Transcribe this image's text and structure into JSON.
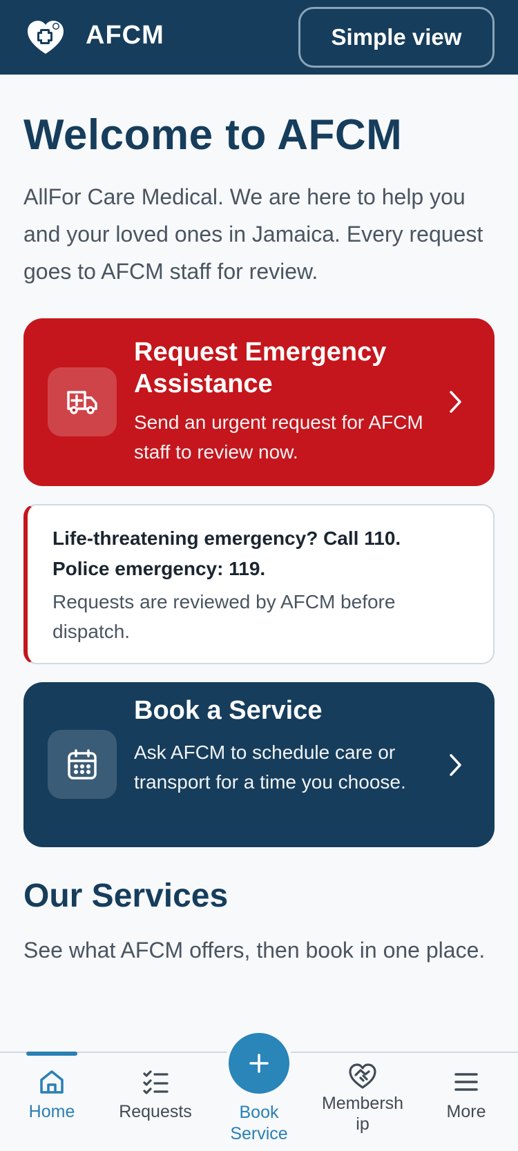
{
  "header": {
    "brand": "AFCM",
    "simple_view_label": "Simple view"
  },
  "main": {
    "title": "Welcome to AFCM",
    "intro": "AllFor Care Medical. We are here to help you and your loved ones in Jamaica. Every request goes to AFCM staff for review."
  },
  "emergency_card": {
    "title": "Request Emergency Assistance",
    "description": "Send an urgent request for AFCM staff to review now.",
    "icon": "ambulance-icon"
  },
  "notice": {
    "line1": "Life-threatening emergency? Call 110.",
    "line2": "Police emergency: 119.",
    "sub": "Requests are reviewed by AFCM before dispatch."
  },
  "book_card": {
    "title": "Book a Service",
    "description": "Ask AFCM to schedule care or transport for a time you choose.",
    "icon": "calendar-icon"
  },
  "services": {
    "title": "Our Services",
    "description": "See what AFCM offers, then book in one place."
  },
  "bottom_nav": {
    "items": [
      {
        "label": "Home",
        "icon": "home-icon",
        "active": true
      },
      {
        "label": "Requests",
        "icon": "checklist-icon"
      },
      {
        "label": "Book Service",
        "icon": "plus-icon"
      },
      {
        "label": "Membersh ip",
        "icon": "heart-handshake-icon"
      },
      {
        "label": "More",
        "icon": "menu-icon"
      }
    ]
  },
  "colors": {
    "primary": "#163d5c",
    "emergency": "#c4161c",
    "accent": "#2a7fb5",
    "background": "#f7f9fb"
  }
}
